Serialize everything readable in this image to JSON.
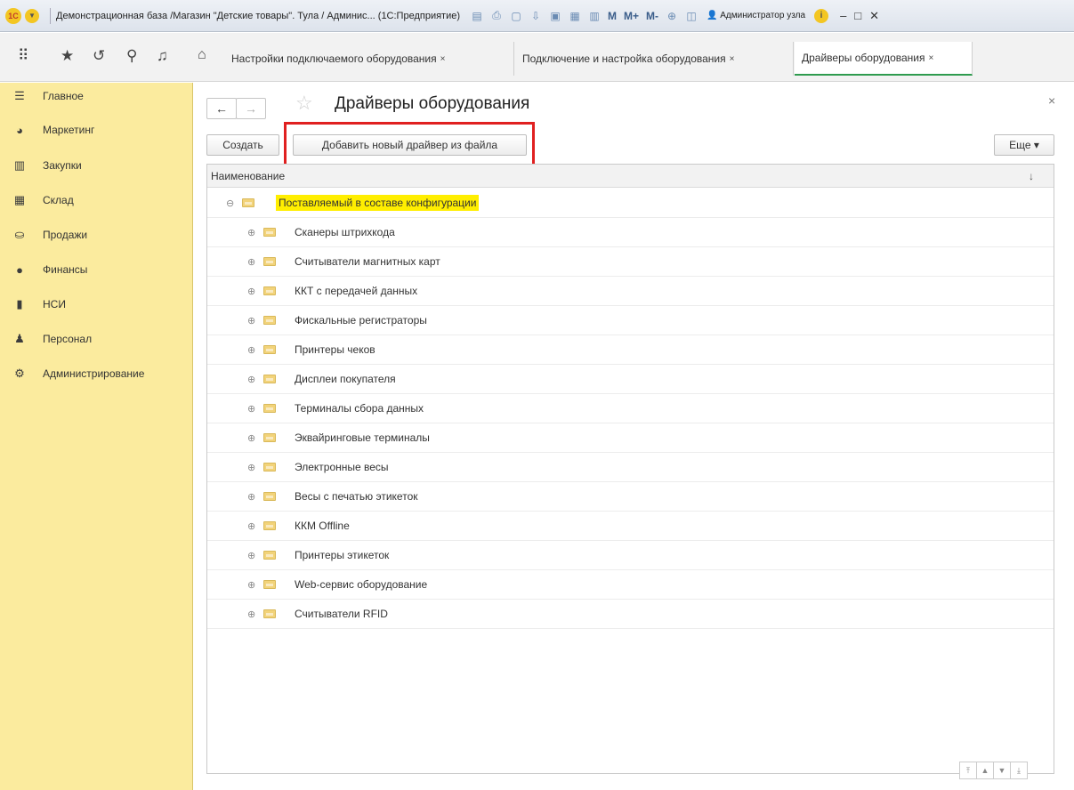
{
  "titlebar": {
    "logo_text": "1С",
    "title": "Демонстрационная база /Магазин \"Детские товары\". Тула / Админис... (1С:Предприятие)",
    "m_label": "M",
    "mplus_label": "M+",
    "mminus_label": "M-",
    "user": "Администратор узла",
    "accent_color": "#f3c623"
  },
  "tabs": [
    {
      "label": "Настройки подключаемого оборудования",
      "close": "×"
    },
    {
      "label": "Подключение и настройка оборудования",
      "close": "×"
    },
    {
      "label": "Драйверы оборудования",
      "close": "×"
    }
  ],
  "sidebar": {
    "background": "#fbeb9e",
    "items": [
      {
        "label": "Главное",
        "icon": "menu-icon"
      },
      {
        "label": "Маркетинг",
        "icon": "pie-chart-icon"
      },
      {
        "label": "Закупки",
        "icon": "purchases-icon"
      },
      {
        "label": "Склад",
        "icon": "warehouse-icon"
      },
      {
        "label": "Продажи",
        "icon": "basket-icon"
      },
      {
        "label": "Финансы",
        "icon": "ruble-icon"
      },
      {
        "label": "НСИ",
        "icon": "book-icon"
      },
      {
        "label": "Персонал",
        "icon": "person-icon"
      },
      {
        "label": "Администрирование",
        "icon": "gear-icon"
      }
    ]
  },
  "form": {
    "title": "Драйверы оборудования",
    "create_label": "Создать",
    "add_driver_label": "Добавить новый драйвер из файла",
    "more_label": "Еще ▾",
    "highlight_color": "#e02020"
  },
  "list": {
    "column_header": "Наименование",
    "sort_indicator": "↓",
    "root": {
      "label": "Поставляемый в составе конфигурации",
      "expander": "⊖"
    },
    "children": [
      {
        "label": "Сканеры штрихкода",
        "expander": "⊕"
      },
      {
        "label": "Считыватели магнитных карт",
        "expander": "⊕"
      },
      {
        "label": "ККТ с передачей данных",
        "expander": "⊕"
      },
      {
        "label": "Фискальные регистраторы",
        "expander": "⊕"
      },
      {
        "label": "Принтеры чеков",
        "expander": "⊕"
      },
      {
        "label": "Дисплеи покупателя",
        "expander": "⊕"
      },
      {
        "label": "Терминалы сбора данных",
        "expander": "⊕"
      },
      {
        "label": "Эквайринговые терминалы",
        "expander": "⊕"
      },
      {
        "label": "Электронные весы",
        "expander": "⊕"
      },
      {
        "label": "Весы с печатью этикеток",
        "expander": "⊕"
      },
      {
        "label": "ККМ Offline",
        "expander": "⊕"
      },
      {
        "label": "Принтеры этикеток",
        "expander": "⊕"
      },
      {
        "label": "Web-сервис оборудование",
        "expander": "⊕"
      },
      {
        "label": "Считыватели RFID",
        "expander": "⊕"
      }
    ]
  }
}
